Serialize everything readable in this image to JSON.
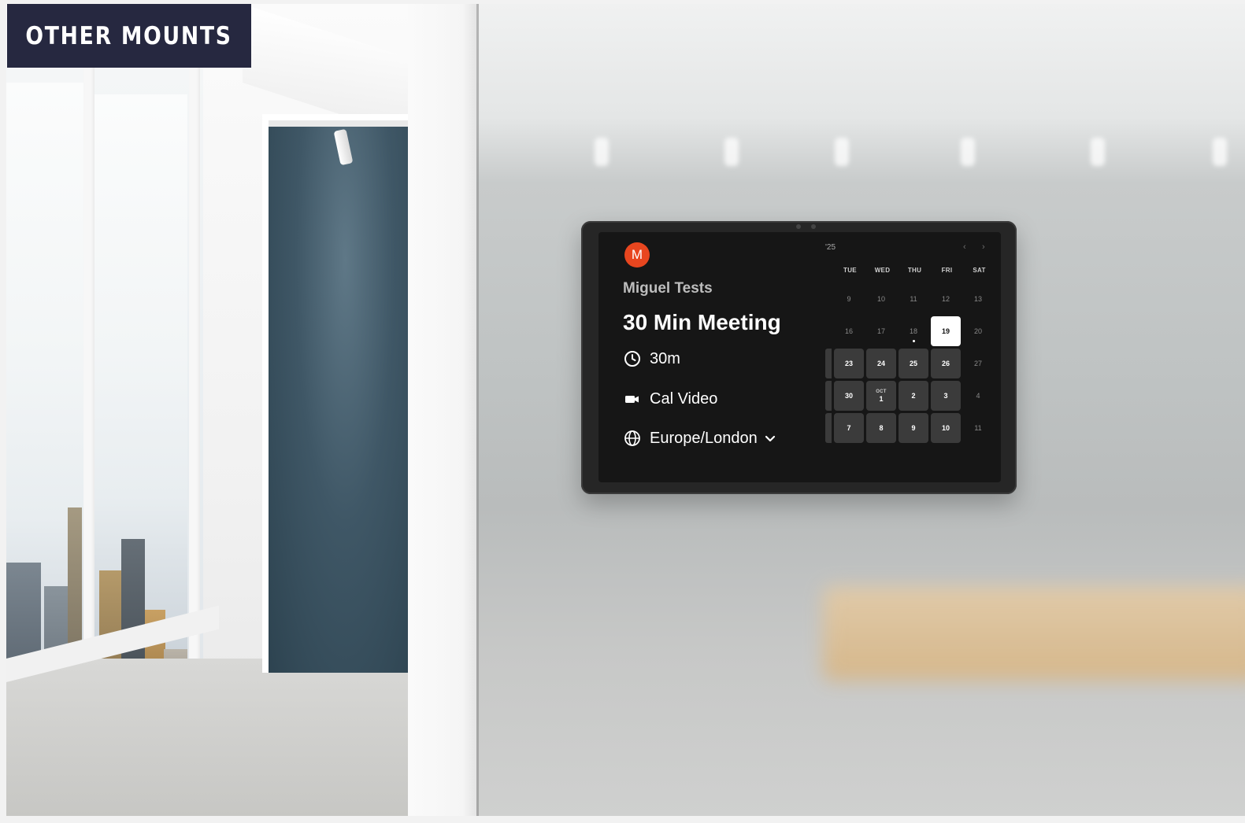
{
  "badge": {
    "label": "OTHER MOUNTS"
  },
  "booking": {
    "avatar_initial": "M",
    "host_name": "Miguel Tests",
    "event_title": "30 Min Meeting",
    "duration": "30m",
    "location": "Cal Video",
    "timezone": "Europe/London"
  },
  "calendar": {
    "month_label": "'25",
    "prev": "‹",
    "next": "›",
    "weekdays": [
      "TUE",
      "WED",
      "THU",
      "FRI",
      "SAT"
    ],
    "weeks": [
      [
        {
          "d": "9",
          "s": "off"
        },
        {
          "d": "10",
          "s": "off"
        },
        {
          "d": "11",
          "s": "off"
        },
        {
          "d": "12",
          "s": "off"
        },
        {
          "d": "13",
          "s": "off"
        }
      ],
      [
        {
          "d": "16",
          "s": "off"
        },
        {
          "d": "17",
          "s": "off"
        },
        {
          "d": "18",
          "s": "today"
        },
        {
          "d": "19",
          "s": "selected"
        },
        {
          "d": "20",
          "s": "off"
        }
      ],
      [
        {
          "d": "23",
          "s": "avail"
        },
        {
          "d": "24",
          "s": "avail"
        },
        {
          "d": "25",
          "s": "avail"
        },
        {
          "d": "26",
          "s": "avail"
        },
        {
          "d": "27",
          "s": "off"
        }
      ],
      [
        {
          "d": "30",
          "s": "avail"
        },
        {
          "d": "1",
          "s": "avail",
          "m": "OCT"
        },
        {
          "d": "2",
          "s": "avail"
        },
        {
          "d": "3",
          "s": "avail"
        },
        {
          "d": "4",
          "s": "off"
        }
      ],
      [
        {
          "d": "7",
          "s": "avail"
        },
        {
          "d": "8",
          "s": "avail"
        },
        {
          "d": "9",
          "s": "avail"
        },
        {
          "d": "10",
          "s": "avail"
        },
        {
          "d": "11",
          "s": "off"
        }
      ]
    ]
  },
  "colors": {
    "badge_bg": "#262840",
    "avatar_bg": "#e8461f",
    "screen_bg": "#161616",
    "available_day_bg": "#3b3b3b",
    "selected_day_bg": "#ffffff"
  },
  "icons": {
    "duration": "clock-icon",
    "location": "video-camera-icon",
    "timezone": "globe-icon",
    "timezone_toggle": "chevron-down-icon"
  }
}
